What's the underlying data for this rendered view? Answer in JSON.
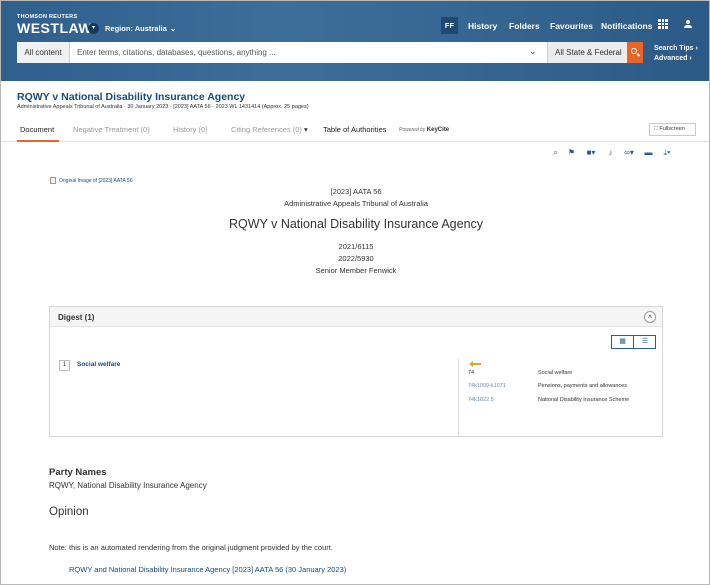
{
  "header": {
    "brand_small": "THOMSON REUTERS",
    "brand": "WESTLAW",
    "region": "Region: Australia",
    "user_initials": "FF",
    "nav": [
      "History",
      "Folders",
      "Favourites",
      "Notifications"
    ]
  },
  "search": {
    "scope": "All content",
    "placeholder": "Enter terms, citations, databases, questions, anything ...",
    "jurisdiction": "All State & Federal",
    "tips": "Search Tips",
    "advanced": "Advanced"
  },
  "document": {
    "title": "RQWY v National Disability Insurance Agency",
    "meta": "Administrative Appeals Tribunal of Australia  ·  30 January 2023  ·  [2023] AATA 56  ·  2023 WL 1431414  (Approx. 25 pages)",
    "tabs": [
      {
        "label": "Document"
      },
      {
        "label": "Negative Treatment (0)"
      },
      {
        "label": "History (0)"
      },
      {
        "label": "Citing References (0)"
      },
      {
        "label": "Table of Authorities"
      }
    ],
    "powered_by": "Powered by",
    "keycite": "KeyCite",
    "fullscreen": "Fullscreen",
    "original_image": "Original Image of [2023] AATA 56",
    "citation": "[2023] AATA 56",
    "court": "Administrative Appeals Tribunal of Australia",
    "case_title": "RQWY v National Disability Insurance Agency",
    "number1": "2021/6115",
    "number2": "2022/5930",
    "member": "Senior Member Fenwick"
  },
  "digest": {
    "title": "Digest (1)",
    "entry_number": "1",
    "entry_label": "Social welfare",
    "key_numbers": [
      {
        "number": "74",
        "description": "Social welfare"
      },
      {
        "number": "74k1009-k1071",
        "description": "Pensions, payments and allowances"
      },
      {
        "number": "74k1022.5",
        "description": "National Disability Insurance Scheme"
      }
    ]
  },
  "body": {
    "party_head": "Party Names",
    "party_names": "RQWY, National Disability Insurance Agency",
    "opinion": "Opinion",
    "note": "Note: this is an automated rendering from the original judgment provided by the court.",
    "case_link": "RQWY and National Disability Insurance Agency [2023] AATA 56 (30 January 2023)"
  },
  "colors": {
    "header_blue": "#2f5f8c",
    "accent_orange": "#e8652a",
    "link_blue": "#1b4a7b"
  }
}
